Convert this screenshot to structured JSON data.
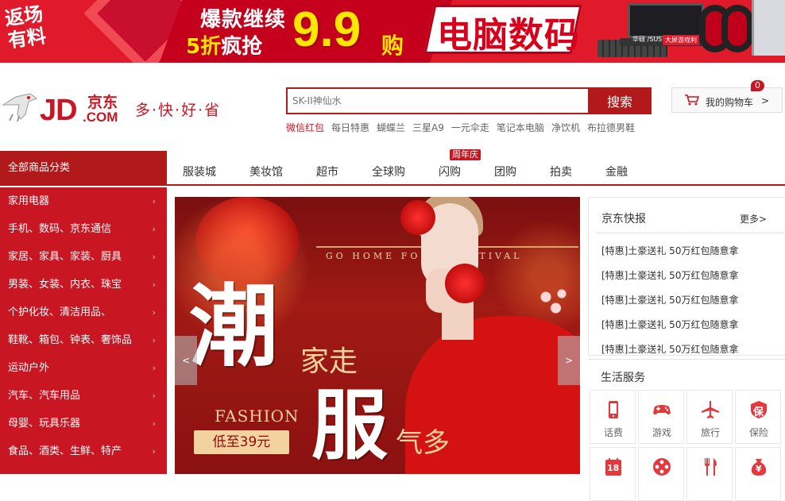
{
  "banner": {
    "fanli": "返场有料",
    "promo_line1": "爆款继续",
    "promo_discount": "5折",
    "promo_line2_suffix": "疯抢",
    "price": "9.9",
    "price_unit": "购",
    "category": "电脑数码",
    "laptop_tag": "大屏游戏利",
    "laptop_brand": "华硕 /SUS"
  },
  "header": {
    "logo_text": "JD",
    "logo_cn": "京东",
    "logo_com": ".COM",
    "slogan": "多·快·好·省",
    "accent_color": "#c81623"
  },
  "search": {
    "placeholder": "SK-II神仙水",
    "button_label": "搜索",
    "hotwords": [
      "微信红包",
      "每日特惠",
      "蝴蝶兰",
      "三星A9",
      "一元伞走",
      "笔记本电脑",
      "净饮机",
      "布拉德男鞋"
    ]
  },
  "cart": {
    "label": "我的购物车",
    "arrow": ">",
    "count": "0",
    "icon": "cart-icon"
  },
  "nav": {
    "all_categories": "全部商品分类",
    "items": [
      "服装城",
      "美妆馆",
      "超市",
      "全球购",
      "闪购",
      "团购",
      "拍卖",
      "金融"
    ],
    "badge": "周年庆"
  },
  "categories": [
    "家用电器",
    "手机、数码、京东通信",
    "家居、家具、家装、厨具",
    "男装、女装、内衣、珠宝",
    "个护化妆、清洁用品、",
    "鞋靴、箱包、钟表、奢饰品",
    "运动户外",
    "汽车、汽车用品",
    "母婴、玩具乐器",
    "食品、酒类、生鲜、特产"
  ],
  "hero": {
    "gate_text": "GO HOME FOR   S FESTIVAL",
    "big1": "潮",
    "small1": "家走",
    "big2": "服",
    "small2": "气多",
    "fashion": "FASHION",
    "price_text": "低至39元",
    "prev": "<",
    "next": ">"
  },
  "news": {
    "title": "京东快报",
    "more": "更多>",
    "items": [
      "[特惠]土豪送礼 50万红包随意拿",
      "[特惠]土豪送礼 50万红包随意拿",
      "[特惠]土豪送礼 50万红包随意拿",
      "[特惠]土豪送礼 50万红包随意拿",
      "[特惠]土豪送礼 50万红包随意拿"
    ]
  },
  "services": {
    "title": "生活服务",
    "items": [
      {
        "label": "话费",
        "icon": "phone-icon"
      },
      {
        "label": "游戏",
        "icon": "gamepad-icon"
      },
      {
        "label": "旅行",
        "icon": "plane-icon"
      },
      {
        "label": "保险",
        "icon": "insurance-icon"
      },
      {
        "label": "",
        "icon": "calendar-icon"
      },
      {
        "label": "",
        "icon": "film-icon"
      },
      {
        "label": "",
        "icon": "food-icon"
      },
      {
        "label": "",
        "icon": "money-bag-icon"
      }
    ],
    "calendar_number": "18",
    "insurance_char": "保",
    "money_char": "¥",
    "icon_color": "#e4393c"
  }
}
